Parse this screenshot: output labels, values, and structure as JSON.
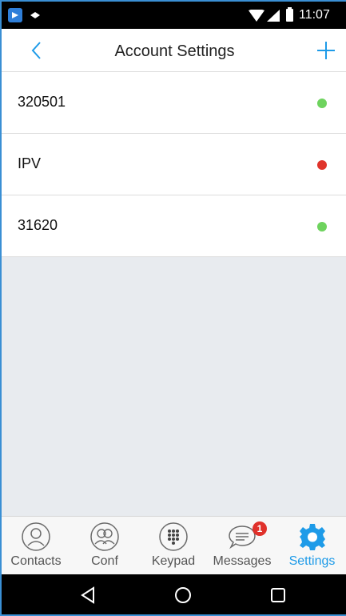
{
  "status_bar": {
    "time": "11:07",
    "icons": [
      "app-icon",
      "notification-icon",
      "wifi-icon",
      "signal-icon",
      "battery-icon"
    ]
  },
  "header": {
    "title": "Account Settings",
    "back_icon": "chevron-left-icon",
    "add_icon": "plus-icon"
  },
  "accounts": [
    {
      "name": "320501",
      "status_color": "#6ed35e"
    },
    {
      "name": "IPV",
      "status_color": "#e0342b"
    },
    {
      "name": "31620",
      "status_color": "#6ed35e"
    }
  ],
  "tabs": [
    {
      "label": "Contacts",
      "icon": "contact-person-icon"
    },
    {
      "label": "Conf",
      "icon": "conference-icon"
    },
    {
      "label": "Keypad",
      "icon": "keypad-icon"
    },
    {
      "label": "Messages",
      "icon": "chat-bubble-icon",
      "badge": "1"
    },
    {
      "label": "Settings",
      "icon": "gear-icon",
      "active": true
    }
  ],
  "nav_bar": {
    "icons": [
      "back-triangle-icon",
      "home-circle-icon",
      "recents-square-icon"
    ]
  },
  "colors": {
    "accent": "#1e9be8",
    "online": "#6ed35e",
    "offline": "#e0342b",
    "badge": "#e0312b"
  }
}
